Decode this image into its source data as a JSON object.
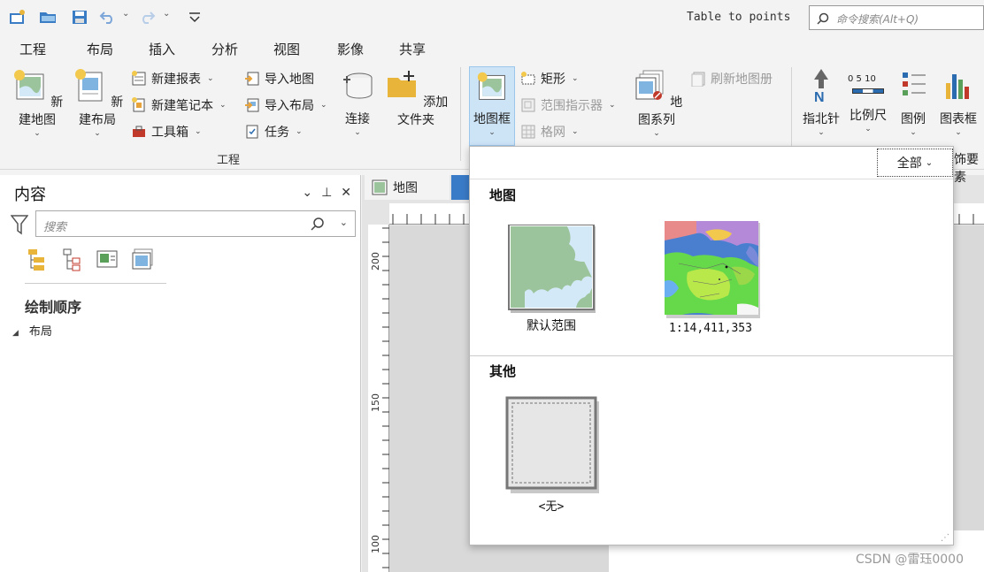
{
  "quick_access": {
    "icons": [
      "new-project-icon",
      "open-project-icon",
      "save-project-icon",
      "undo-icon",
      "redo-icon",
      "customize-icon"
    ],
    "document_title": "Table to points",
    "command_search_placeholder": "命令搜索(Alt+Q)"
  },
  "tabs": [
    {
      "label": "工程"
    },
    {
      "label": "布局"
    },
    {
      "label": "插入",
      "active": true
    },
    {
      "label": "分析"
    },
    {
      "label": "视图"
    },
    {
      "label": "影像"
    },
    {
      "label": "共享"
    }
  ],
  "ribbon": {
    "project_group": {
      "label": "工程",
      "new_map": "新建地图",
      "new_layout": "新建布局",
      "new_report": "新建报表",
      "new_notebook": "新建笔记本",
      "toolbox": "工具箱",
      "import_map": "导入地图",
      "import_layout": "导入布局",
      "task": "任务",
      "connect": "连接",
      "add_folder": "添加文件夹"
    },
    "map_frames_group": {
      "map_frame": "地图框",
      "rectangle": "矩形",
      "extent_indicator": "范围指示器",
      "grid": "格网",
      "map_series": "地图系列",
      "refresh_map_series": "刷新地图册"
    },
    "map_surrounds_group": {
      "north_arrow": "指北针",
      "scale_bar": "比例尺",
      "scale_bar_ticks": "0 5 10",
      "legend": "图例",
      "chart_frame": "图表框",
      "partial_label": "饰要素"
    }
  },
  "contents_pane": {
    "title": "内容",
    "search_placeholder": "搜索",
    "section_title": "绘制顺序",
    "tree_item": "布局"
  },
  "doc_tabs": {
    "map_tab": "地图"
  },
  "ruler": {
    "labels": [
      "200",
      "150",
      "100"
    ]
  },
  "gallery": {
    "filter_label": "全部",
    "sections": [
      {
        "title": "地图",
        "items": [
          "默认范围",
          "1:14,411,353"
        ]
      },
      {
        "title": "其他",
        "items": [
          "<无>"
        ]
      }
    ]
  },
  "watermark": "CSDN @雷珏0000",
  "colors": {
    "accent": "#2b6cb0",
    "map_frame_highlight": "#cde4f7",
    "map_land": "#9cc49c",
    "map_water": "#d4e9f7"
  }
}
